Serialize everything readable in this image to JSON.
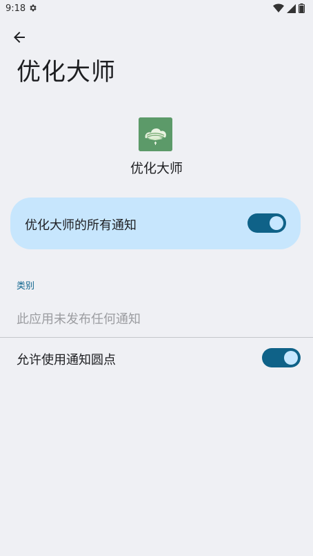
{
  "status_bar": {
    "time": "9:18",
    "icons": [
      "settings-gear-icon",
      "wifi-icon",
      "cell-signal-icon",
      "battery-icon"
    ]
  },
  "header": {
    "title": "优化大师",
    "back_icon": "arrow-back-icon"
  },
  "app": {
    "name": "优化大师",
    "icon_color": "#5c9a69"
  },
  "main_toggle": {
    "label": "优化大师的所有通知",
    "enabled": true
  },
  "categories": {
    "section_label": "类别",
    "empty_message": "此应用未发布任何通知"
  },
  "notification_dot": {
    "label": "允许使用通知圆点",
    "enabled": true
  },
  "colors": {
    "background": "#eff0f4",
    "card": "#c7e6fd",
    "accent": "#0f6288",
    "section_label": "#10658e"
  }
}
